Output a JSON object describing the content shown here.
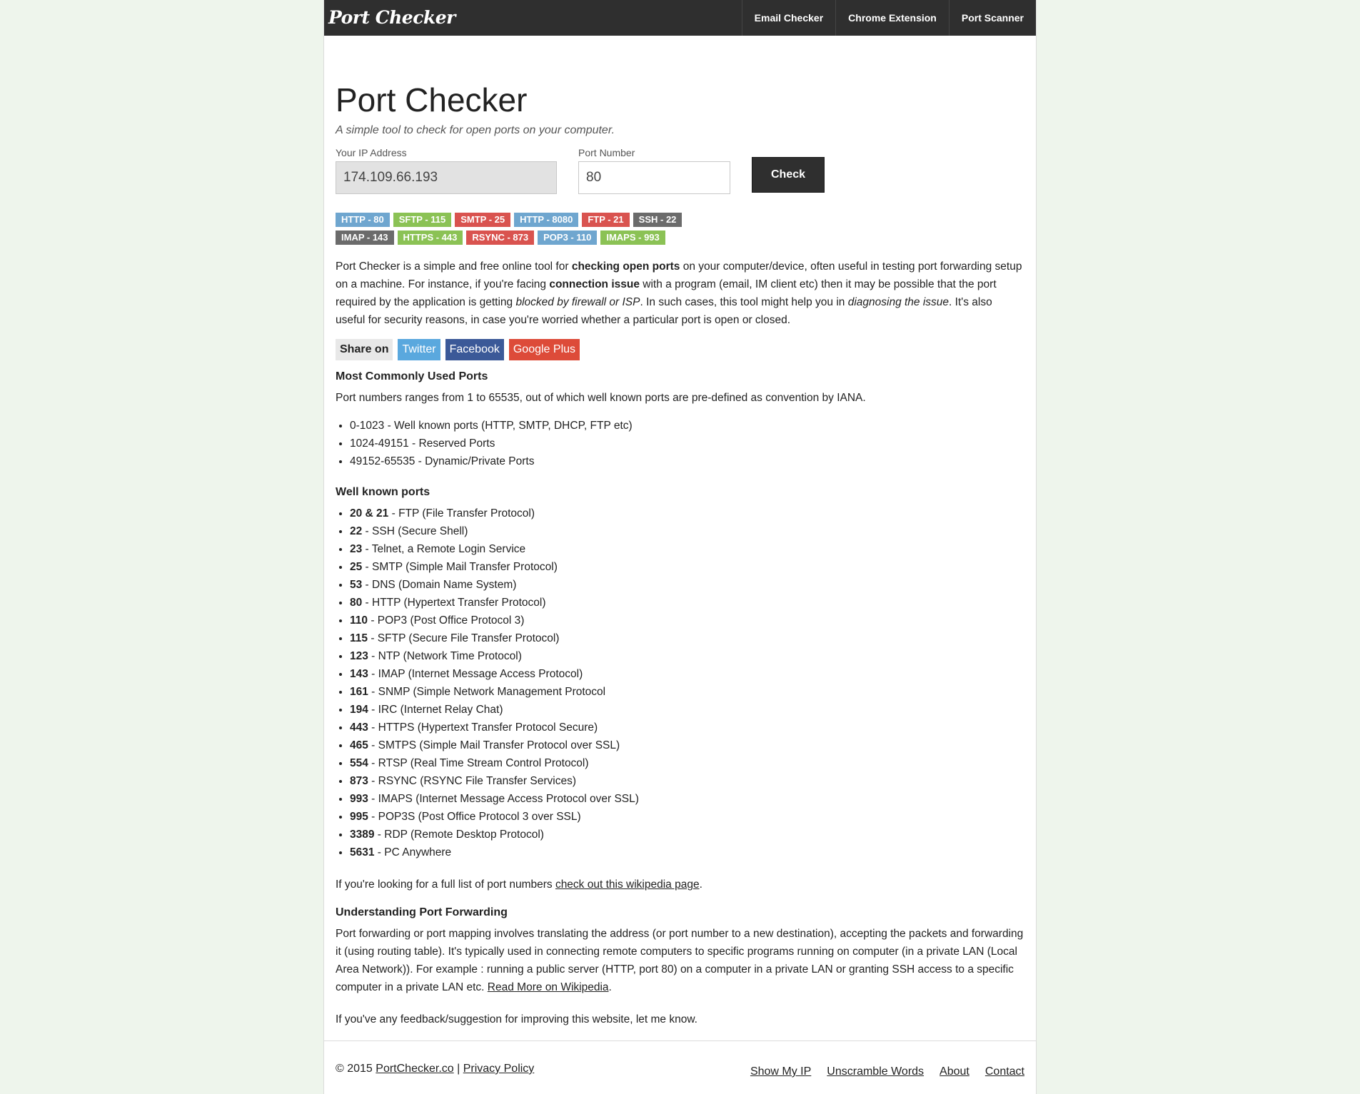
{
  "nav": {
    "brand": "Port Checker",
    "links": [
      "Email Checker",
      "Chrome Extension",
      "Port Scanner"
    ]
  },
  "header": {
    "title": "Port Checker",
    "subtitle": "A simple tool to check for open ports on your computer."
  },
  "form": {
    "ip_label": "Your IP Address",
    "ip_value": "174.109.66.193",
    "port_label": "Port Number",
    "port_value": "80",
    "check_label": "Check"
  },
  "badges": {
    "row1": [
      "HTTP - 80",
      "SFTP - 115",
      "SMTP - 25",
      "HTTP - 8080",
      "FTP - 21",
      "SSH - 22"
    ],
    "row2": [
      "IMAP - 143",
      "HTTPS - 443",
      "RSYNC - 873",
      "POP3 - 110",
      "IMAPS - 993"
    ]
  },
  "intro": {
    "t1": "Port Checker is a simple and free online tool for ",
    "b1": "checking open ports",
    "t2": " on your computer/device, often useful in testing port forwarding setup on a machine. For instance, if you're facing ",
    "b2": "connection issue",
    "t3": " with a program (email, IM client etc) then it may be possible that the port required by the application is getting ",
    "i1": "blocked by firewall or ISP",
    "t4": ". In such cases, this tool might help you in ",
    "i2": "diagnosing the issue",
    "t5": ". It's also useful for security reasons, in case you're worried whether a particular port is open or closed."
  },
  "share": {
    "label": "Share on",
    "twitter": "Twitter",
    "facebook": "Facebook",
    "google": "Google Plus"
  },
  "common": {
    "heading": "Most Commonly Used Ports",
    "text": "Port numbers ranges from 1 to 65535, out of which well known ports are pre-defined as convention by IANA.",
    "ranges": [
      "0-1023 - Well known ports (HTTP, SMTP, DHCP, FTP etc)",
      "1024-49151 - Reserved Ports",
      "49152-65535 - Dynamic/Private Ports"
    ]
  },
  "wellknown": {
    "heading": "Well known ports",
    "ports": [
      {
        "num": "20 & 21",
        "desc": " - FTP (File Transfer Protocol)"
      },
      {
        "num": "22",
        "desc": " - SSH (Secure Shell)"
      },
      {
        "num": "23",
        "desc": " - Telnet, a Remote Login Service"
      },
      {
        "num": "25",
        "desc": " - SMTP (Simple Mail Transfer Protocol)"
      },
      {
        "num": "53",
        "desc": " - DNS (Domain Name System)"
      },
      {
        "num": "80",
        "desc": " - HTTP (Hypertext Transfer Protocol)"
      },
      {
        "num": "110",
        "desc": " - POP3 (Post Office Protocol 3)"
      },
      {
        "num": "115",
        "desc": " - SFTP (Secure File Transfer Protocol)"
      },
      {
        "num": "123",
        "desc": " - NTP (Network Time Protocol)"
      },
      {
        "num": "143",
        "desc": " - IMAP (Internet Message Access Protocol)"
      },
      {
        "num": "161",
        "desc": " - SNMP (Simple Network Management Protocol"
      },
      {
        "num": "194",
        "desc": " - IRC (Internet Relay Chat)"
      },
      {
        "num": "443",
        "desc": " - HTTPS (Hypertext Transfer Protocol Secure)"
      },
      {
        "num": "465",
        "desc": " - SMTPS (Simple Mail Transfer Protocol over SSL)"
      },
      {
        "num": "554",
        "desc": " - RTSP (Real Time Stream Control Protocol)"
      },
      {
        "num": "873",
        "desc": " - RSYNC (RSYNC File Transfer Services)"
      },
      {
        "num": "993",
        "desc": " - IMAPS (Internet Message Access Protocol over SSL)"
      },
      {
        "num": "995",
        "desc": " - POP3S (Post Office Protocol 3 over SSL)"
      },
      {
        "num": "3389",
        "desc": " - RDP (Remote Desktop Protocol)"
      },
      {
        "num": "5631",
        "desc": " - PC Anywhere"
      }
    ]
  },
  "wiki": {
    "t1": "If you're looking for a full list of port numbers ",
    "link": "check out this wikipedia page",
    "t2": "."
  },
  "forwarding": {
    "heading": "Understanding Port Forwarding",
    "text": "Port forwarding or port mapping involves translating the address (or port number to a new destination), accepting the packets and forwarding it (using routing table). It's typically used in connecting remote computers to specific programs running on computer (in a private LAN (Local Area Network)). For example : running a public server (HTTP, port 80) on a computer in a private LAN or granting SSH access to a specific computer in a private LAN etc. ",
    "link": "Read More on Wikipedia",
    "end": "."
  },
  "feedback": "If you've any feedback/suggestion for improving this website, let me know.",
  "footer": {
    "copyright": "© 2015 ",
    "site": "PortChecker.co",
    "sep": " | ",
    "privacy": "Privacy Policy",
    "links": [
      "Show My IP",
      "Unscramble Words",
      "About",
      "Contact"
    ]
  },
  "colors": {
    "nav_bg": "#2f2f2f",
    "badge_blue": "#6fa6cf",
    "badge_green": "#8bc255",
    "badge_red": "#d9534f",
    "badge_gray": "#6b6b6b",
    "twitter": "#5aa8de",
    "facebook": "#3b5998",
    "google": "#dd4b39"
  }
}
